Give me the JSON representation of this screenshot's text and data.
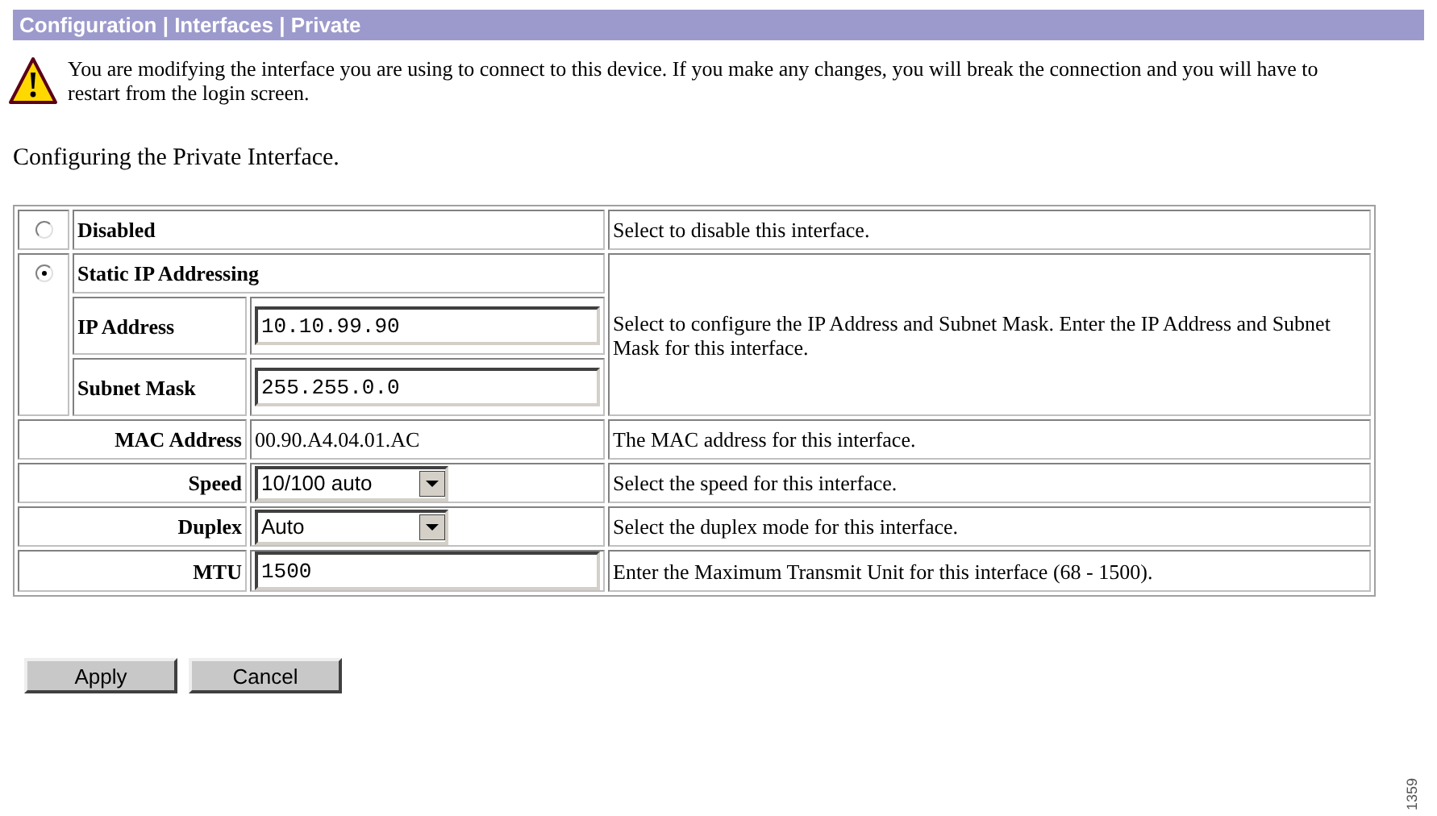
{
  "header": {
    "title": "Configuration | Interfaces | Private"
  },
  "warning": {
    "text": "You are modifying the interface you are using to connect to this device. If you make any changes, you will break the connection and you will have to restart from the login screen."
  },
  "heading": "Configuring the Private Interface.",
  "modes": [
    {
      "label": "Disabled",
      "selected": false,
      "description": "Select to disable this interface."
    },
    {
      "label": "Static IP Addressing",
      "selected": true,
      "description": "Select to configure the IP Address and Subnet Mask. Enter the IP Address and Subnet Mask for this interface.",
      "fields": [
        {
          "label": "IP Address",
          "value": "10.10.99.90"
        },
        {
          "label": "Subnet Mask",
          "value": "255.255.0.0"
        }
      ]
    }
  ],
  "settings": [
    {
      "kind": "text",
      "label": "MAC Address",
      "value": "00.90.A4.04.01.AC",
      "description": "The MAC address for this interface."
    },
    {
      "kind": "select",
      "label": "Speed",
      "value": "10/100 auto",
      "description": "Select the speed for this interface."
    },
    {
      "kind": "select",
      "label": "Duplex",
      "value": "Auto",
      "description": "Select the duplex mode for this interface."
    },
    {
      "kind": "input",
      "label": "MTU",
      "value": "1500",
      "description": "Enter the Maximum Transmit Unit for this interface (68 - 1500)."
    }
  ],
  "buttons": [
    "Apply",
    "Cancel"
  ],
  "figure_number": "1359"
}
